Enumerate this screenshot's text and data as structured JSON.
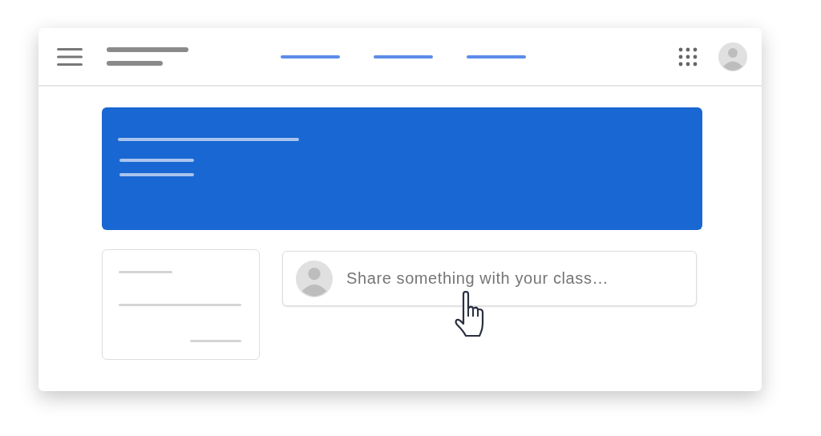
{
  "composer": {
    "placeholder": "Share something with your class…"
  }
}
